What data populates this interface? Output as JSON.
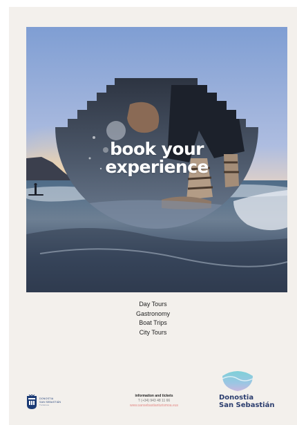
{
  "headline": {
    "line1": "book your",
    "line2": "experience"
  },
  "services": [
    "Day Tours",
    "Gastronomy",
    "Boat Trips",
    "City Tours"
  ],
  "footer": {
    "seal": {
      "line1": "DONOSTIA",
      "line2": "SAN SEBASTIÁN",
      "line3": "Turismoa"
    },
    "info_title": "information and tickets",
    "phone": "T (+34) 943 48 11 66",
    "website": "www.sansebastianturismoa.eus",
    "brand": {
      "line1": "Donostia",
      "line2": "San Sebastián"
    }
  },
  "colors": {
    "poster_bg": "#f3f0ec",
    "brand_navy": "#2b3d6e",
    "link_pink": "#e38a86"
  },
  "icons": [
    "city-seal-icon",
    "brand-wave-logo-icon"
  ]
}
